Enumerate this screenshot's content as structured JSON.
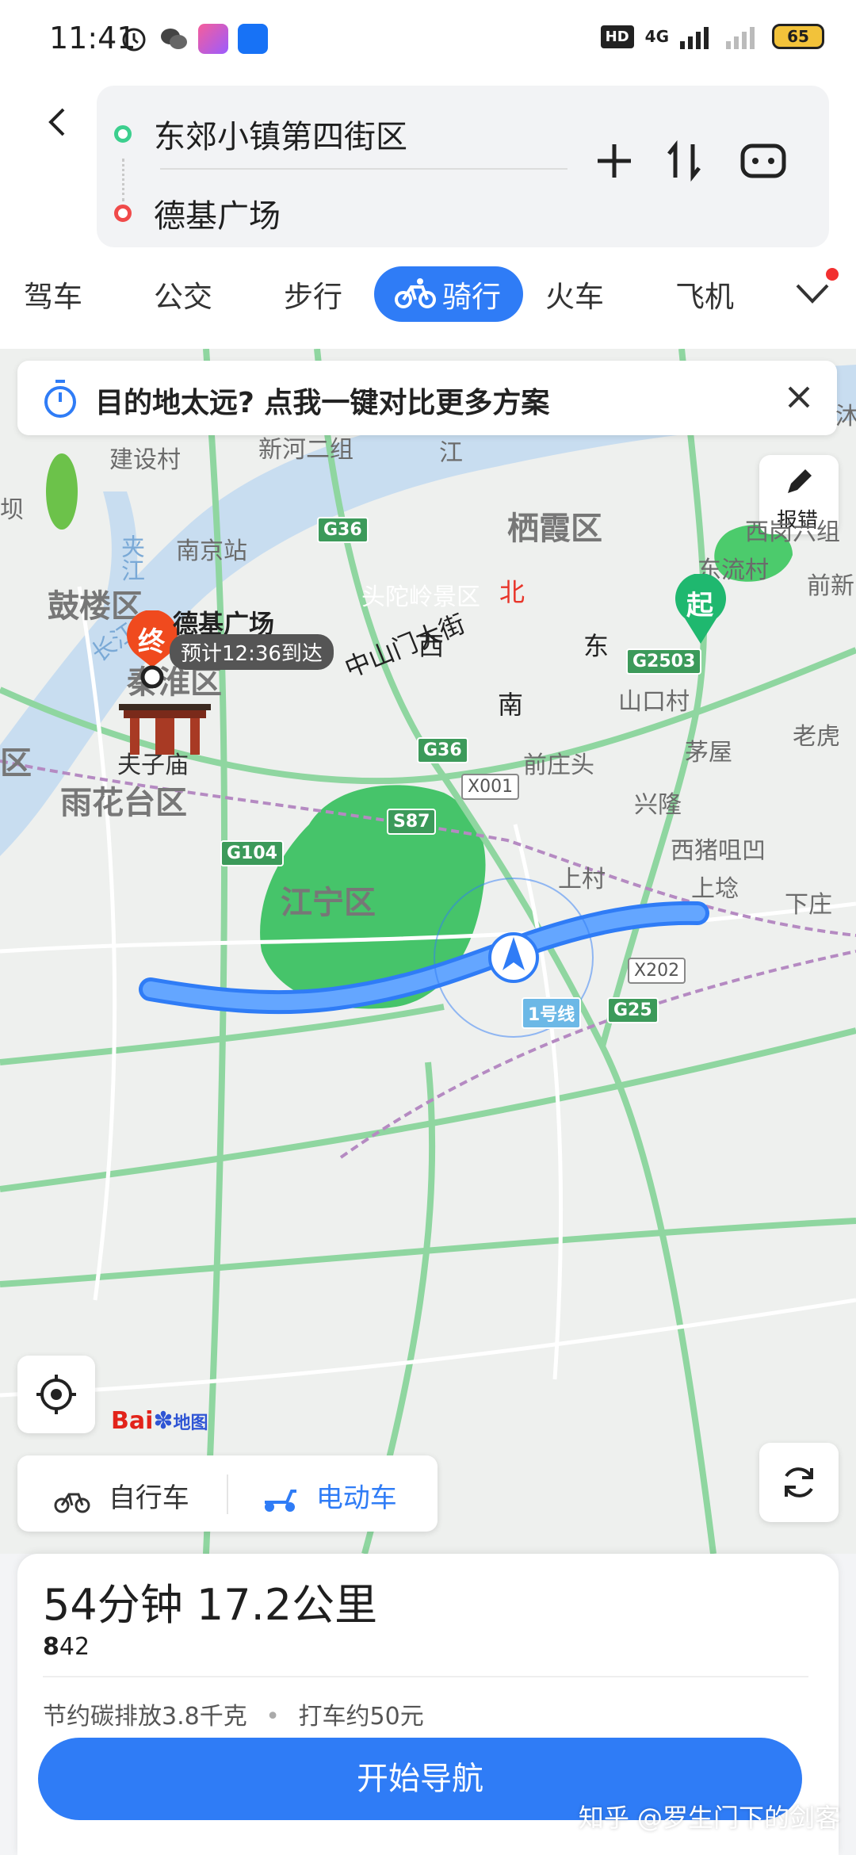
{
  "status": {
    "time": "11:41",
    "hd": "HD",
    "network": "4G",
    "battery": "65"
  },
  "header": {
    "start": "东郊小镇第四街区",
    "end": "德基广场"
  },
  "modes": [
    {
      "label": "驾车"
    },
    {
      "label": "公交"
    },
    {
      "label": "步行"
    },
    {
      "label": "骑行"
    },
    {
      "label": "火车"
    },
    {
      "label": "飞机"
    }
  ],
  "banner": {
    "text": "目的地太远? 点我一键对比更多方案"
  },
  "map": {
    "report_label": "报错",
    "labels": [
      "建设村",
      "新河二组",
      "江",
      "夹江",
      "长江",
      "栖霞区",
      "西岗六组",
      "东流村",
      "前新",
      "南京站",
      "鼓楼区",
      "头陀岭景区",
      "秦淮区",
      "夫子庙",
      "雨花台区",
      "区",
      "山口村",
      "茅屋",
      "老虎",
      "前庄头",
      "兴隆",
      "西猪咀凹",
      "上村",
      "上埝",
      "下庄",
      "江宁区",
      "坝",
      "沐"
    ],
    "roads": [
      "G36",
      "G36",
      "G2503",
      "S87",
      "G104",
      "X001",
      "X202",
      "G25",
      "1号线"
    ],
    "street": "中山门大街",
    "compass": {
      "north": "北",
      "south": "南",
      "east": "东",
      "west": "西"
    },
    "start_badge": "起",
    "end_badge": "终",
    "end_name": "德基广场",
    "eta": "预计12:36到达",
    "baidu_logo": "Bai",
    "baidu_logo2": "地图"
  },
  "vehicle": {
    "bike": "自行车",
    "ebike": "电动车"
  },
  "summary": {
    "duration_distance": "54分钟  17.2公里",
    "lights": "42",
    "carbon": "节约碳排放3.8千克",
    "taxi": "打车约50元",
    "nav_button": "开始导航"
  },
  "watermark": "知乎 @罗生门下的剑客",
  "colors": {
    "accent": "#2f7cf6",
    "route": "#4a90e2",
    "start": "#1fb86f",
    "end": "#f04a1e"
  }
}
